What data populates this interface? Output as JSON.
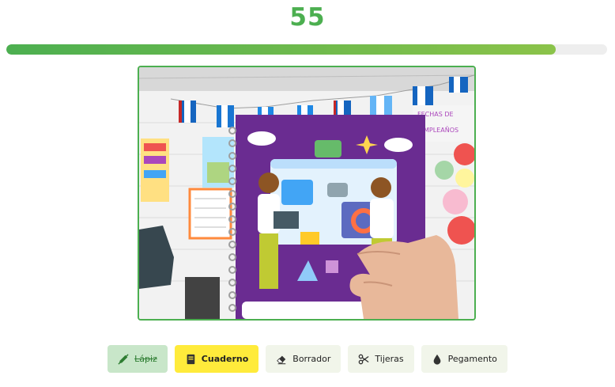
{
  "game": {
    "score": "55",
    "progress": 0.915,
    "progress_color_start": "#4caf50",
    "progress_color_end": "#8bc34a"
  },
  "camera_feed": {
    "description_icon": "webcam-photo"
  },
  "items": [
    {
      "label": "Lápiz",
      "icon": "pencil-icon",
      "state": "done"
    },
    {
      "label": "Cuaderno",
      "icon": "notebook-icon",
      "state": "active"
    },
    {
      "label": "Borrador",
      "icon": "eraser-icon",
      "state": "pending"
    },
    {
      "label": "Tijeras",
      "icon": "scissors-icon",
      "state": "pending"
    },
    {
      "label": "Pegamento",
      "icon": "glue-icon",
      "state": "pending"
    }
  ],
  "colors": {
    "accent": "#4caf50",
    "done_bg": "#c8e6c9",
    "active_bg": "#ffeb3b",
    "pending_bg": "#f1f5ea"
  }
}
